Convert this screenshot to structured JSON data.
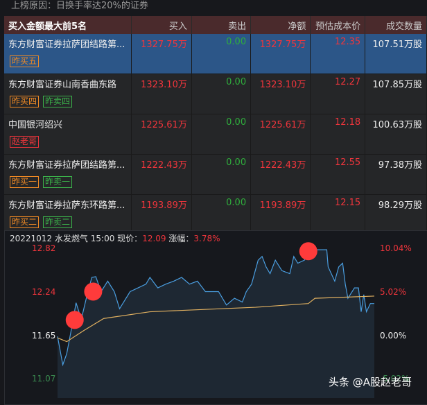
{
  "reason": "上榜原因：日换手率达20%的证券",
  "table": {
    "headers": [
      "买入金额最大前5名",
      "买入",
      "卖出",
      "净额",
      "预估成本价",
      "成交数量"
    ],
    "rows": [
      {
        "name": "东方财富证券拉萨团结路第...",
        "buy": "1327.75万",
        "sell": "0.00",
        "net": "1327.75万",
        "cost": "12.35",
        "volume": "107.51万股",
        "tags": [
          {
            "text": "昨买五",
            "color": "o"
          }
        ]
      },
      {
        "name": "东方财富证券山南香曲东路",
        "buy": "1323.10万",
        "sell": "0.00",
        "net": "1323.10万",
        "cost": "12.27",
        "volume": "107.85万股",
        "tags": [
          {
            "text": "昨买四",
            "color": "o"
          },
          {
            "text": "昨卖四",
            "color": "g"
          }
        ]
      },
      {
        "name": "中国银河绍兴",
        "buy": "1225.61万",
        "sell": "0.00",
        "net": "1225.61万",
        "cost": "12.18",
        "volume": "100.63万股",
        "tags": [
          {
            "text": "赵老哥",
            "color": "r"
          }
        ]
      },
      {
        "name": "东方财富证券拉萨团结路第...",
        "buy": "1222.43万",
        "sell": "0.00",
        "net": "1222.43万",
        "cost": "12.55",
        "volume": "97.38万股",
        "tags": [
          {
            "text": "昨买一",
            "color": "o"
          },
          {
            "text": "昨卖一",
            "color": "g"
          }
        ]
      },
      {
        "name": "东方财富证券拉萨东环路第...",
        "buy": "1193.89万",
        "sell": "0.00",
        "net": "1193.89万",
        "cost": "12.15",
        "volume": "98.29万股",
        "tags": [
          {
            "text": "昨买二",
            "color": "o"
          },
          {
            "text": "昨卖二",
            "color": "g"
          }
        ]
      }
    ]
  },
  "chart": {
    "date": "20221012",
    "stock": "水发燃气",
    "time": "15:00",
    "price_label": "现价：",
    "price": "12.09",
    "change_label": "涨幅：",
    "change": "3.78%",
    "left_ticks": [
      "12.82",
      "12.24",
      "11.65",
      "11.07"
    ],
    "right_ticks": [
      "10.04%",
      "5.02%",
      "0.00%",
      "-5.02%"
    ]
  },
  "chart_data": {
    "type": "line",
    "xlim": [
      0,
      240
    ],
    "ylim": [
      11.07,
      12.82
    ],
    "base": 11.65,
    "price": [
      [
        0,
        11.64
      ],
      [
        4,
        11.26
      ],
      [
        7,
        11.41
      ],
      [
        11,
        11.78
      ],
      [
        14,
        12.09
      ],
      [
        18,
        11.87
      ],
      [
        23,
        12.24
      ],
      [
        26,
        12.43
      ],
      [
        29,
        12.44
      ],
      [
        33,
        12.24
      ],
      [
        38,
        12.38
      ],
      [
        43,
        12.24
      ],
      [
        47,
        12.01
      ],
      [
        55,
        12.24
      ],
      [
        61,
        12.29
      ],
      [
        67,
        12.34
      ],
      [
        70,
        12.43
      ],
      [
        76,
        12.29
      ],
      [
        82,
        12.34
      ],
      [
        88,
        12.38
      ],
      [
        94,
        12.43
      ],
      [
        100,
        12.34
      ],
      [
        106,
        12.38
      ],
      [
        112,
        12.24
      ],
      [
        122,
        12.24
      ],
      [
        128,
        12.06
      ],
      [
        134,
        12.15
      ],
      [
        140,
        12.1
      ],
      [
        143,
        12.24
      ],
      [
        147,
        12.34
      ],
      [
        152,
        12.66
      ],
      [
        155,
        12.71
      ],
      [
        158,
        12.57
      ],
      [
        161,
        12.48
      ],
      [
        165,
        12.66
      ],
      [
        170,
        12.52
      ],
      [
        176,
        12.48
      ],
      [
        179,
        12.71
      ],
      [
        182,
        12.62
      ],
      [
        187,
        12.66
      ],
      [
        191,
        12.76
      ],
      [
        197,
        12.8
      ],
      [
        204,
        12.8
      ],
      [
        205,
        12.57
      ],
      [
        210,
        12.38
      ],
      [
        213,
        12.57
      ],
      [
        216,
        12.62
      ],
      [
        218,
        12.34
      ],
      [
        220,
        12.15
      ],
      [
        225,
        12.29
      ],
      [
        228,
        12.29
      ],
      [
        230,
        11.97
      ],
      [
        232,
        12.2
      ],
      [
        234,
        11.97
      ],
      [
        237,
        12.08
      ],
      [
        240,
        12.08
      ]
    ],
    "avg": [
      [
        0,
        11.62
      ],
      [
        7,
        11.57
      ],
      [
        20,
        11.72
      ],
      [
        35,
        11.88
      ],
      [
        70,
        11.97
      ],
      [
        150,
        12.03
      ],
      [
        190,
        12.08
      ],
      [
        195,
        12.15
      ],
      [
        240,
        12.18
      ]
    ],
    "markers": [
      [
        13,
        11.86
      ],
      [
        27,
        12.24
      ],
      [
        190,
        12.78
      ]
    ]
  },
  "watermark": "头条 @A股赵老哥",
  "colors": {
    "price": "#4a9ee0",
    "avg": "#e0b060",
    "marker": "#ff3b3b"
  }
}
